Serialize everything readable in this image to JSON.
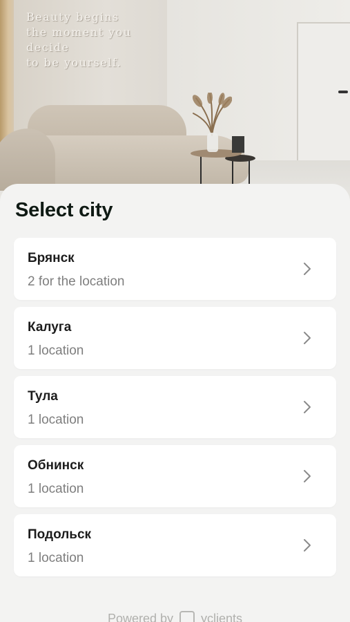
{
  "hero": {
    "wall_text_lines": [
      "Beauty begins",
      "the moment you decide",
      "to be yourself."
    ]
  },
  "sheet": {
    "title": "Select city"
  },
  "cities": [
    {
      "name": "Брянск",
      "count": "2 for the location"
    },
    {
      "name": "Калуга",
      "count": "1 location"
    },
    {
      "name": "Тула",
      "count": "1 location"
    },
    {
      "name": "Обнинск",
      "count": "1 location"
    },
    {
      "name": "Подольск",
      "count": "1 location"
    }
  ],
  "footer": {
    "powered_by": "Powered by",
    "brand": "yclients",
    "brand_icon": "yclients-logo-icon"
  },
  "icons": {
    "card_action": "chevron-right-icon"
  },
  "colors": {
    "title": "#0f1a14",
    "card_bg": "#ffffff",
    "sheet_bg": "#f3f3f2",
    "secondary_text": "#7e7e7e"
  }
}
